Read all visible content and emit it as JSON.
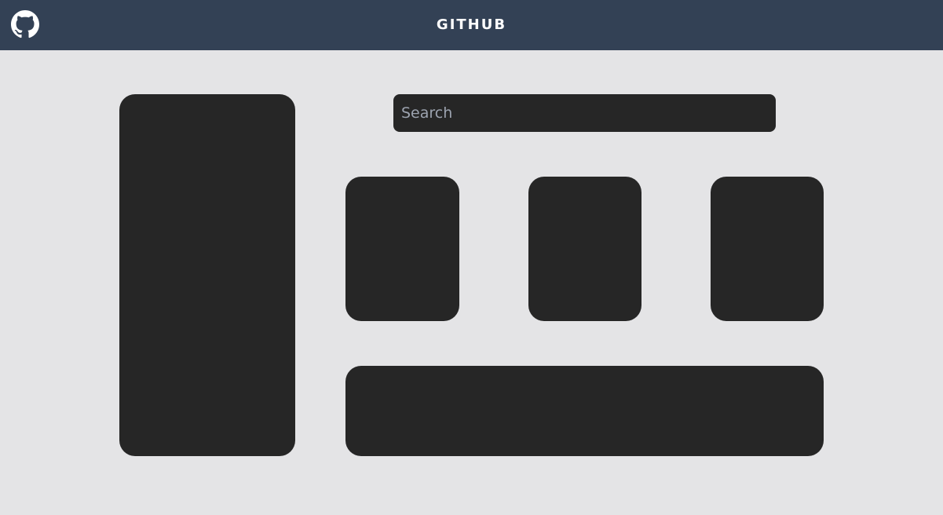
{
  "header": {
    "title": "GITHUB",
    "logo_icon": "github-icon",
    "background": "#334155"
  },
  "search": {
    "placeholder": "Search",
    "value": ""
  },
  "colors": {
    "page_background": "#e4e4e6",
    "panel_background": "#262626"
  }
}
